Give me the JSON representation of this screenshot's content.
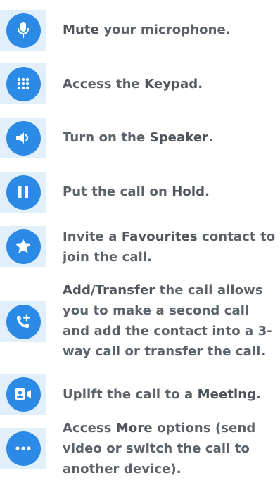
{
  "colors": {
    "tile": "#e1effb",
    "circle": "#2b8ae6",
    "icon": "#ffffff",
    "text": "#5c626a"
  },
  "items": [
    {
      "icon": "microphone-icon",
      "parts": [
        {
          "text": "Mute",
          "bold": true
        },
        {
          "text": " your microphone.",
          "bold": false
        }
      ]
    },
    {
      "icon": "keypad-icon",
      "parts": [
        {
          "text": "Access the ",
          "bold": false
        },
        {
          "text": "Keypad",
          "bold": true
        },
        {
          "text": ".",
          "bold": false
        }
      ]
    },
    {
      "icon": "speaker-icon",
      "parts": [
        {
          "text": "Turn on the ",
          "bold": false
        },
        {
          "text": "Speaker",
          "bold": true
        },
        {
          "text": ".",
          "bold": false
        }
      ]
    },
    {
      "icon": "pause-icon",
      "parts": [
        {
          "text": "Put the call on ",
          "bold": false
        },
        {
          "text": "Hold",
          "bold": true
        },
        {
          "text": ".",
          "bold": false
        }
      ]
    },
    {
      "icon": "star-icon",
      "parts": [
        {
          "text": "Invite a ",
          "bold": false
        },
        {
          "text": "Favourites",
          "bold": true
        },
        {
          "text": " contact to join the call.",
          "bold": false
        }
      ]
    },
    {
      "icon": "phone-add-icon",
      "parts": [
        {
          "text": "Add/Transfer",
          "bold": true
        },
        {
          "text": " the call allows you to make a second call and add the contact into a 3-way call or transfer the call.",
          "bold": false
        }
      ]
    },
    {
      "icon": "meeting-icon",
      "parts": [
        {
          "text": "Uplift the call to a ",
          "bold": false
        },
        {
          "text": "Meeting",
          "bold": true
        },
        {
          "text": ".",
          "bold": false
        }
      ]
    },
    {
      "icon": "more-options-icon",
      "parts": [
        {
          "text": "Access ",
          "bold": false
        },
        {
          "text": "More",
          "bold": true
        },
        {
          "text": " options (send video or switch the call to another device).",
          "bold": false
        }
      ]
    }
  ]
}
